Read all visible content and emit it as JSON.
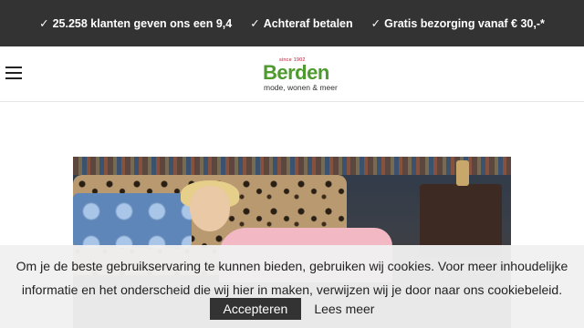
{
  "topbar": {
    "usps": [
      {
        "icon": "check-icon",
        "text": "25.258 klanten geven ons een 9,4"
      },
      {
        "icon": "check-icon",
        "text": "Achteraf betalen"
      },
      {
        "icon": "check-icon",
        "text": "Gratis bezorging vanaf € 30,-*"
      }
    ]
  },
  "header": {
    "menu_icon": "hamburger-icon",
    "logo": {
      "since": "since 1902",
      "name": "Berden",
      "tagline": "mode, wonen & meer"
    }
  },
  "colors": {
    "topbar_bg": "#333333",
    "brand_green": "#4e9a2e",
    "accept_bg": "#333333"
  },
  "cookie_banner": {
    "message": "Om je de beste gebruikservaring te kunnen bieden, gebruiken wij cookies. Voor meer inhoudelijke informatie en het onderscheid die wij hier in maken, verwijzen wij je door naar ons cookiebeleid.",
    "accept_label": "Accepteren",
    "more_label": "Lees meer"
  }
}
